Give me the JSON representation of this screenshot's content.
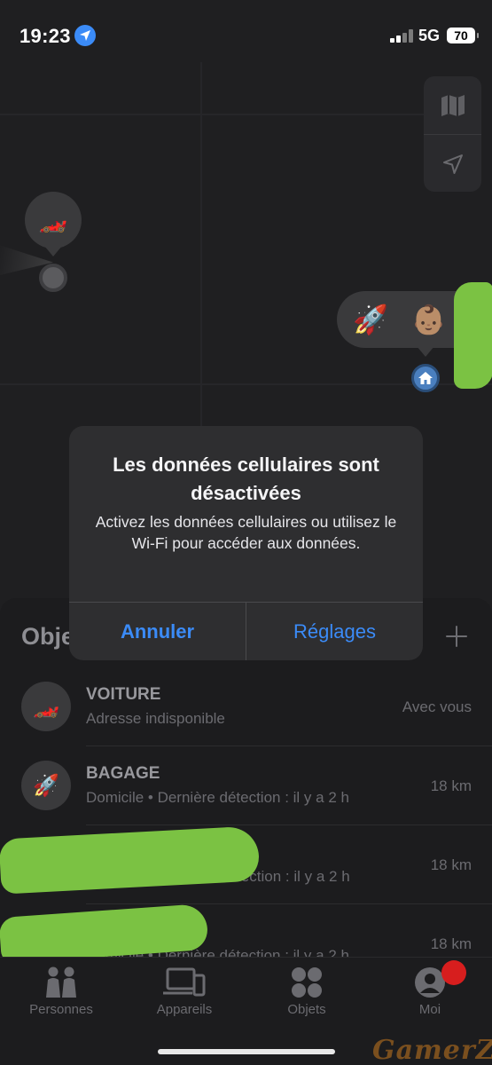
{
  "status_bar": {
    "time": "19:23",
    "network": "5G",
    "battery": "70"
  },
  "map": {
    "car_pin_emoji": "🏎️",
    "cluster_emojis": [
      "🚀",
      "👶🏽"
    ],
    "home_icon": "house-icon"
  },
  "sheet": {
    "title": "Obje",
    "items": [
      {
        "emoji": "🏎️",
        "name": "VOITURE",
        "sub": "Adresse indisponible",
        "right": "Avec vous"
      },
      {
        "emoji": "🚀",
        "name": "BAGAGE",
        "sub": "Domicile • Dernière détection : il y a 2 h",
        "right": "18 km"
      },
      {
        "emoji": "",
        "name": "",
        "sub": "rnière détection : il y a 2 h",
        "right": "18 km"
      },
      {
        "emoji": "",
        "name": "",
        "sub": "Domicile • Dernière détection : il y a 2 h",
        "right": "18 km"
      }
    ]
  },
  "tabs": [
    {
      "label": "Personnes",
      "icon": "people-icon"
    },
    {
      "label": "Appareils",
      "icon": "devices-icon"
    },
    {
      "label": "Objets",
      "icon": "items-icon"
    },
    {
      "label": "Moi",
      "icon": "me-icon"
    }
  ],
  "alert": {
    "title": "Les données cellulaires sont désactivées",
    "message": "Activez les données cellulaires ou utilisez le Wi-Fi pour accéder aux données.",
    "cancel_label": "Annuler",
    "settings_label": "Réglages"
  },
  "watermark": "GamerZ",
  "colors": {
    "accent": "#3b8bf7",
    "badge": "#d71e1e",
    "scribble": "#7bc243"
  }
}
